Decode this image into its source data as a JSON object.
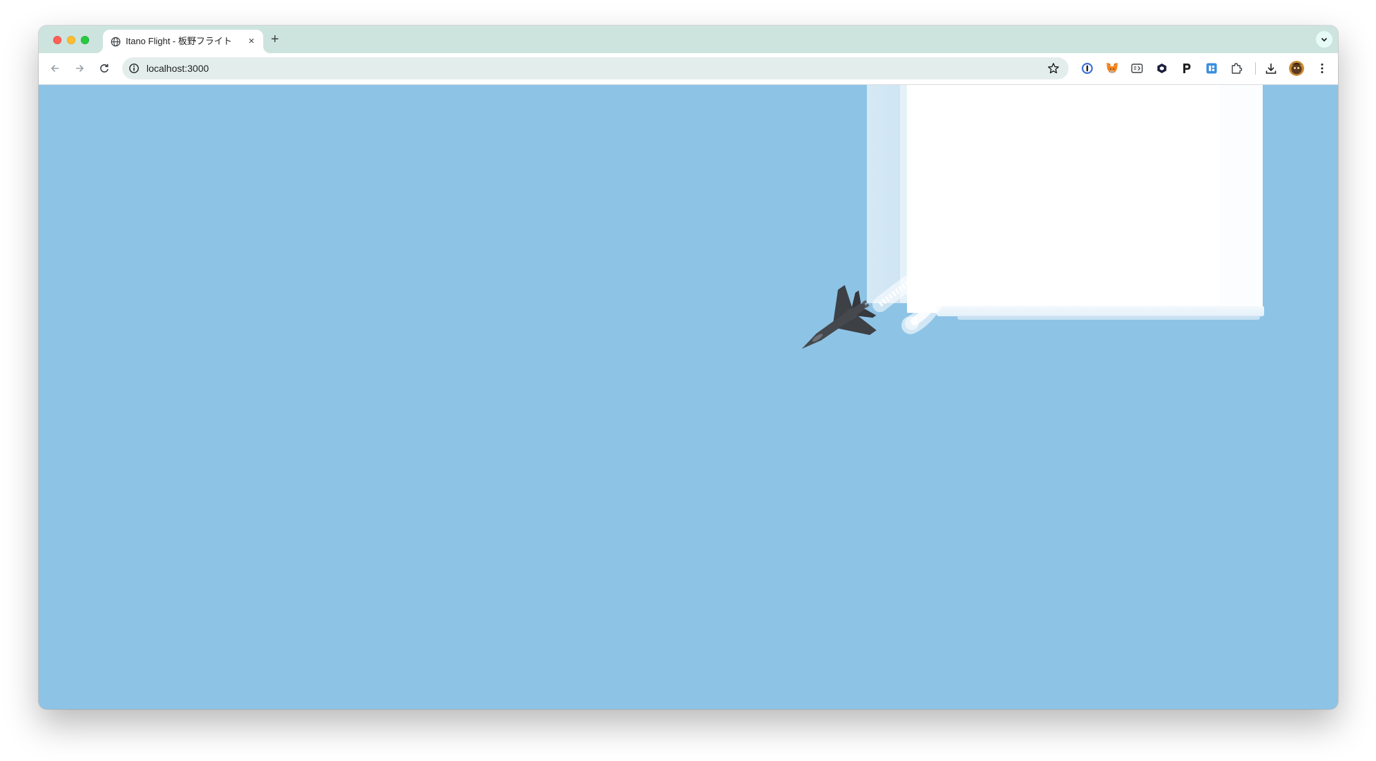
{
  "browser": {
    "tab": {
      "title": "Itano Flight - 板野フライト",
      "close_glyph": "×",
      "favicon": "globe-icon"
    },
    "new_tab_glyph": "+",
    "address": {
      "url": "localhost:3000",
      "info_icon": "site-info-icon",
      "star_icon": "bookmark-star-icon"
    },
    "extensions": [
      "1password-icon",
      "metamask-icon",
      "reader-icon",
      "hex-extension-icon",
      "p-extension-icon",
      "blue-extension-icon",
      "puzzle-extensions-icon",
      "download-icon",
      "profile-avatar",
      "more-menu-icon"
    ]
  },
  "game": {
    "sky_color": "#8dc3e5",
    "cloud_color": "#ffffff",
    "jet_color": "#3f4247",
    "objects": [
      "cloud-block",
      "fighter-jet",
      "contrail"
    ]
  }
}
